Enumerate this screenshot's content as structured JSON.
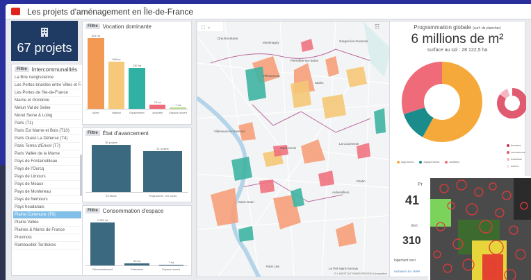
{
  "app": {
    "title": "Les projets d'aménagement en Île-de-France"
  },
  "count": {
    "value": "67 projets",
    "icon": "building-icon"
  },
  "filters": {
    "label": "Filtre"
  },
  "intercos": {
    "title": "Intercommunalités",
    "items": [
      "La Brie nangissienne",
      "Les Portes briardes entre Villes et Forêts",
      "Les Portes de l'Ile-de-France",
      "Marne et Gondoire",
      "Melun Val de Seine",
      "Moret Seine & Loing",
      "Paris (T1)",
      "Paris Est Marne et Bois (T10)",
      "Paris Ouest La Défense (T4)",
      "Paris Terres d'Envol (T7)",
      "Paris Vallée de la Marne",
      "Pays de Fontainebleau",
      "Pays de l'Ourcq",
      "Pays de Limours",
      "Pays de Meaux",
      "Pays de Montereau",
      "Pays de Nemours",
      "Pays houdanais",
      "Plaine Commune (T6)",
      "Plaine Vallée",
      "Plaines & Monts de France",
      "Provinois",
      "Rambouillet Territoires"
    ],
    "selected_index": 18
  },
  "vocation": {
    "title": "Vocation dominante",
    "bars": [
      {
        "label": "Mixte",
        "value_label": "401 ha",
        "value": 401,
        "color": "#f29a54"
      },
      {
        "label": "Habitat",
        "value_label": "266 ha",
        "value": 266,
        "color": "#f6c97a"
      },
      {
        "label": "Equipement",
        "value_label": "230 ha",
        "value": 230,
        "color": "#2fb1a3"
      },
      {
        "label": "Activités",
        "value_label": "23 ha",
        "value": 23,
        "color": "#f06b7a"
      },
      {
        "label": "Espace ouvert",
        "value_label": "7 ha",
        "value": 7,
        "color": "#b9d98b"
      }
    ]
  },
  "avancement": {
    "title": "État d'avancement",
    "bars": [
      {
        "label": "À l'étude",
        "value_label": "36 projets",
        "value": 36,
        "color": "#3b6a80"
      },
      {
        "label": "Programmé - En cours",
        "value_label": "31 projets",
        "value": 31,
        "color": "#3b6a80"
      }
    ]
  },
  "consommation": {
    "title": "Consommation d'espace",
    "bars": [
      {
        "label": "Renouvellement",
        "value_label": "1 200 ha",
        "value": 1200,
        "color": "#3b6a80"
      },
      {
        "label": "Extension",
        "value_label": "53 ha",
        "value": 53,
        "color": "#3b6a80"
      },
      {
        "label": "Espace ouvert",
        "value_label": "7 ha",
        "value": 7,
        "color": "#3b6a80"
      }
    ]
  },
  "map": {
    "places": [
      "Dreuil-la-Barre",
      "Montmagny",
      "Garges-lès-Gonesse",
      "Pierrefitte-sur-Seine",
      "Villetaneuse",
      "Stains",
      "Villeneuve-la-Garenne",
      "Saint-Denis",
      "La Courneuve",
      "Aubervilliers",
      "Saint-Ouen",
      "Pantin",
      "Paris 18e",
      "Le Pré-Saint-Gervais"
    ],
    "credit": "© L'INSTITUT PARIS REGION Occupation"
  },
  "programmation": {
    "title": "Programmation globale",
    "title_note": "(surf. de plancher)",
    "total": "6 millions de m²",
    "surface": "surface au sol : 28 122,5 ha",
    "donut1": {
      "values": [
        58,
        12,
        30
      ],
      "colors": [
        "#f6a93b",
        "#1a8c8c",
        "#f06b7a"
      ]
    },
    "donut2": {
      "values": [
        85,
        10,
        5
      ],
      "colors": [
        "#e05a70",
        "#f6b6c1",
        "#ffffff"
      ]
    },
    "legend": [
      {
        "label": "logements",
        "color": "#f6a93b"
      },
      {
        "label": "équipements",
        "color": "#1a8c8c"
      },
      {
        "label": "activités",
        "color": "#f06b7a"
      }
    ],
    "legend2": [
      {
        "label": "bureaux",
        "color": "#c8344e"
      },
      {
        "label": "commerces",
        "color": "#e05a70"
      },
      {
        "label": "hôtellerie",
        "color": "#f6b6c1"
      },
      {
        "label": "autres",
        "color": "#fbe0e5"
      }
    ],
    "kpi1": "41",
    "kpi2": "310",
    "dont": "dont",
    "logement_label": "logement soci",
    "datatoolbox": "DATABOX DU TERR"
  }
}
